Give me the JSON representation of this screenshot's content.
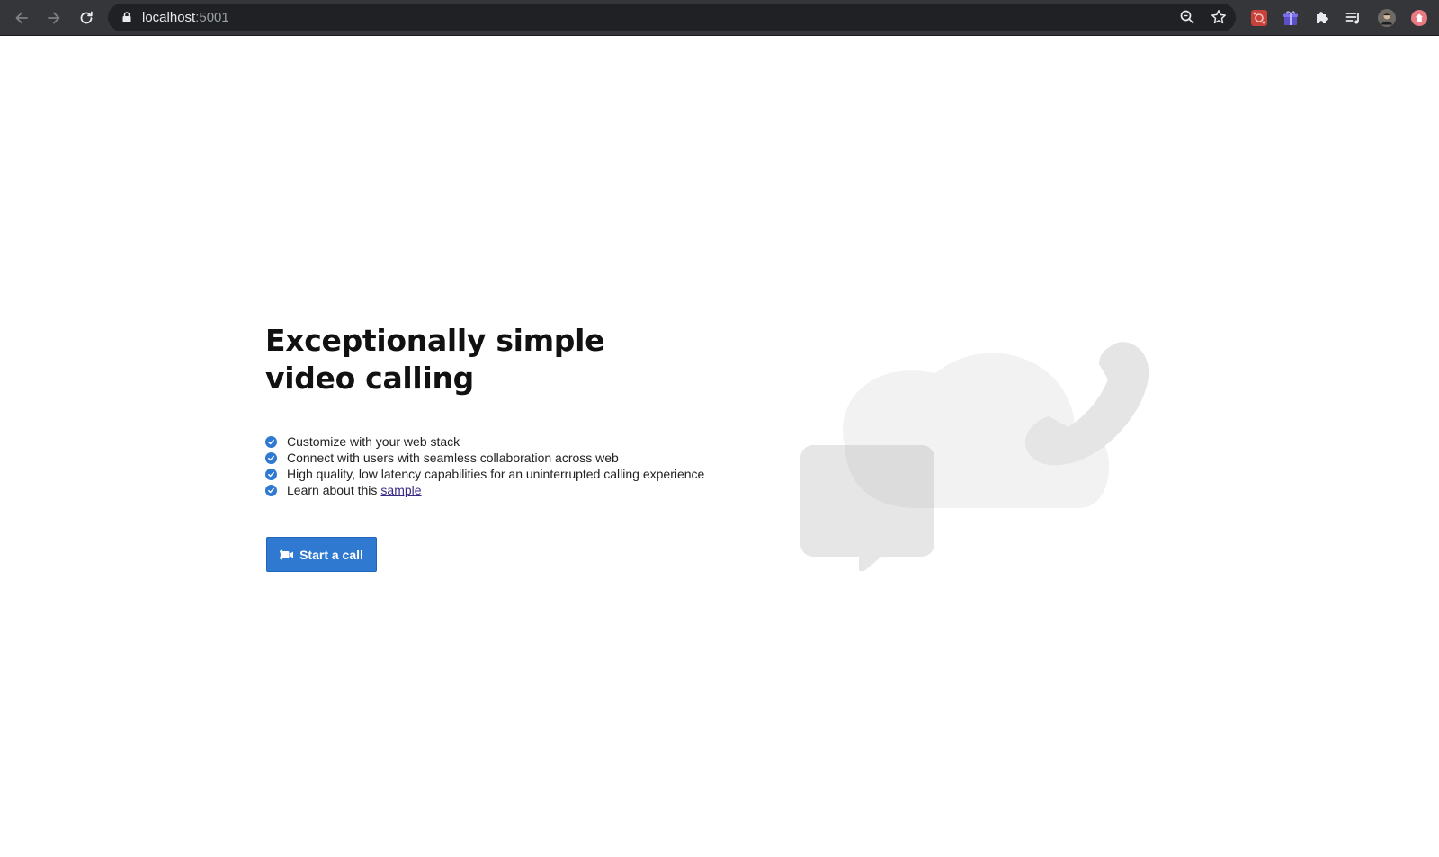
{
  "browser": {
    "url_host": "localhost",
    "url_port": ":5001",
    "icons": [
      "back-arrow-icon",
      "forward-arrow-icon",
      "reload-icon",
      "lock-icon",
      "zoom-icon",
      "bookmark-star-icon",
      "extension-red-icon",
      "extension-gift-icon",
      "extensions-puzzle-icon",
      "reading-list-icon",
      "profile-avatar",
      "extension-pink-icon"
    ]
  },
  "hero": {
    "headline_line1": "Exceptionally simple",
    "headline_line2": "video calling"
  },
  "features": [
    {
      "text": "Customize with your web stack"
    },
    {
      "text": "Connect with users with seamless collaboration across web"
    },
    {
      "text": "High quality, low latency capabilities for an uninterrupted calling experience"
    },
    {
      "text": "Learn about this",
      "link": "sample"
    }
  ],
  "cta": {
    "label": "Start a call"
  },
  "colors": {
    "accent": "#2f79d0",
    "toolbar": "#35363a",
    "omnibox": "#202124",
    "link": "#3a2a86"
  }
}
